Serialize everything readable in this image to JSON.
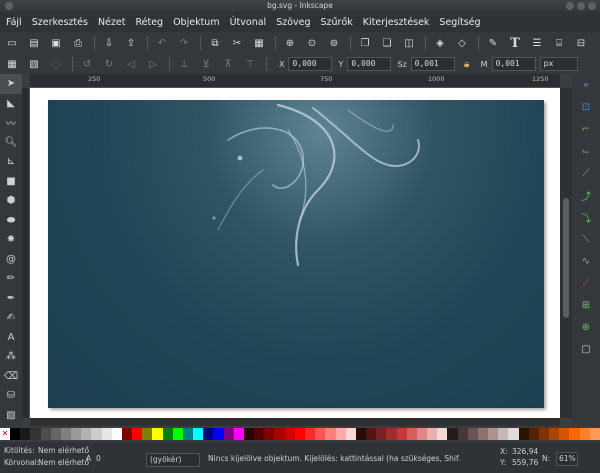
{
  "window": {
    "title": "bg.svg - Inkscape"
  },
  "menu": [
    "Fájl",
    "Szerkesztés",
    "Nézet",
    "Réteg",
    "Objektum",
    "Útvonal",
    "Szöveg",
    "Szűrők",
    "Kiterjesztések",
    "Segítség"
  ],
  "toolbar2": {
    "x_label": "X",
    "x_value": "0,000",
    "y_label": "Y",
    "y_value": "0,000",
    "w_label": "Sz",
    "w_value": "0,001",
    "h_label": "M",
    "h_value": "0,001",
    "unit": "px"
  },
  "ruler": {
    "marks": [
      "250",
      "500",
      "750",
      "1000",
      "1250"
    ]
  },
  "status": {
    "fill_label": "Kitöltés:",
    "fill_value": "Nem elérhető",
    "stroke_label": "Körvonal:",
    "stroke_value": "Nem elérhető",
    "opacity_label": "A",
    "opacity_value": "0",
    "layer": "(gyökér)",
    "message": "Nincs kijelölve objektum. Kijelölés: kattintással (ha szükséges, Shif.",
    "cursor_x_label": "X:",
    "cursor_x": "326,94",
    "cursor_y_label": "Y:",
    "cursor_y": "559,76",
    "zoom_label": "N:",
    "zoom": "61%"
  },
  "colors": {
    "canvas_bg": "#1b3f50",
    "accent_green": "#6fbf6a"
  },
  "palette": [
    "#000000",
    "#1a1a1a",
    "#333333",
    "#4d4d4d",
    "#666666",
    "#808080",
    "#999999",
    "#b3b3b3",
    "#cccccc",
    "#e6e6e6",
    "#ffffff",
    "#800000",
    "#ff0000",
    "#808000",
    "#ffff00",
    "#008000",
    "#00ff00",
    "#008080",
    "#00ffff",
    "#000080",
    "#0000ff",
    "#800080",
    "#ff00ff",
    "#2b0000",
    "#550000",
    "#800000",
    "#aa0000",
    "#d40000",
    "#ff0000",
    "#ff2a2a",
    "#ff5555",
    "#ff8080",
    "#ffaaaa",
    "#ffd5d5",
    "#280b0b",
    "#501616",
    "#782121",
    "#a02c2c",
    "#c83737",
    "#d35f5f",
    "#de8787",
    "#e9afaf",
    "#f4d7d7",
    "#241c1c",
    "#483737",
    "#6c5353",
    "#916f6f",
    "#ac9393",
    "#c8b7b7",
    "#e3dbdb",
    "#2b1100",
    "#552200",
    "#803300",
    "#aa4400",
    "#d45500",
    "#ff6600",
    "#ff7f2a",
    "#ff9955"
  ]
}
